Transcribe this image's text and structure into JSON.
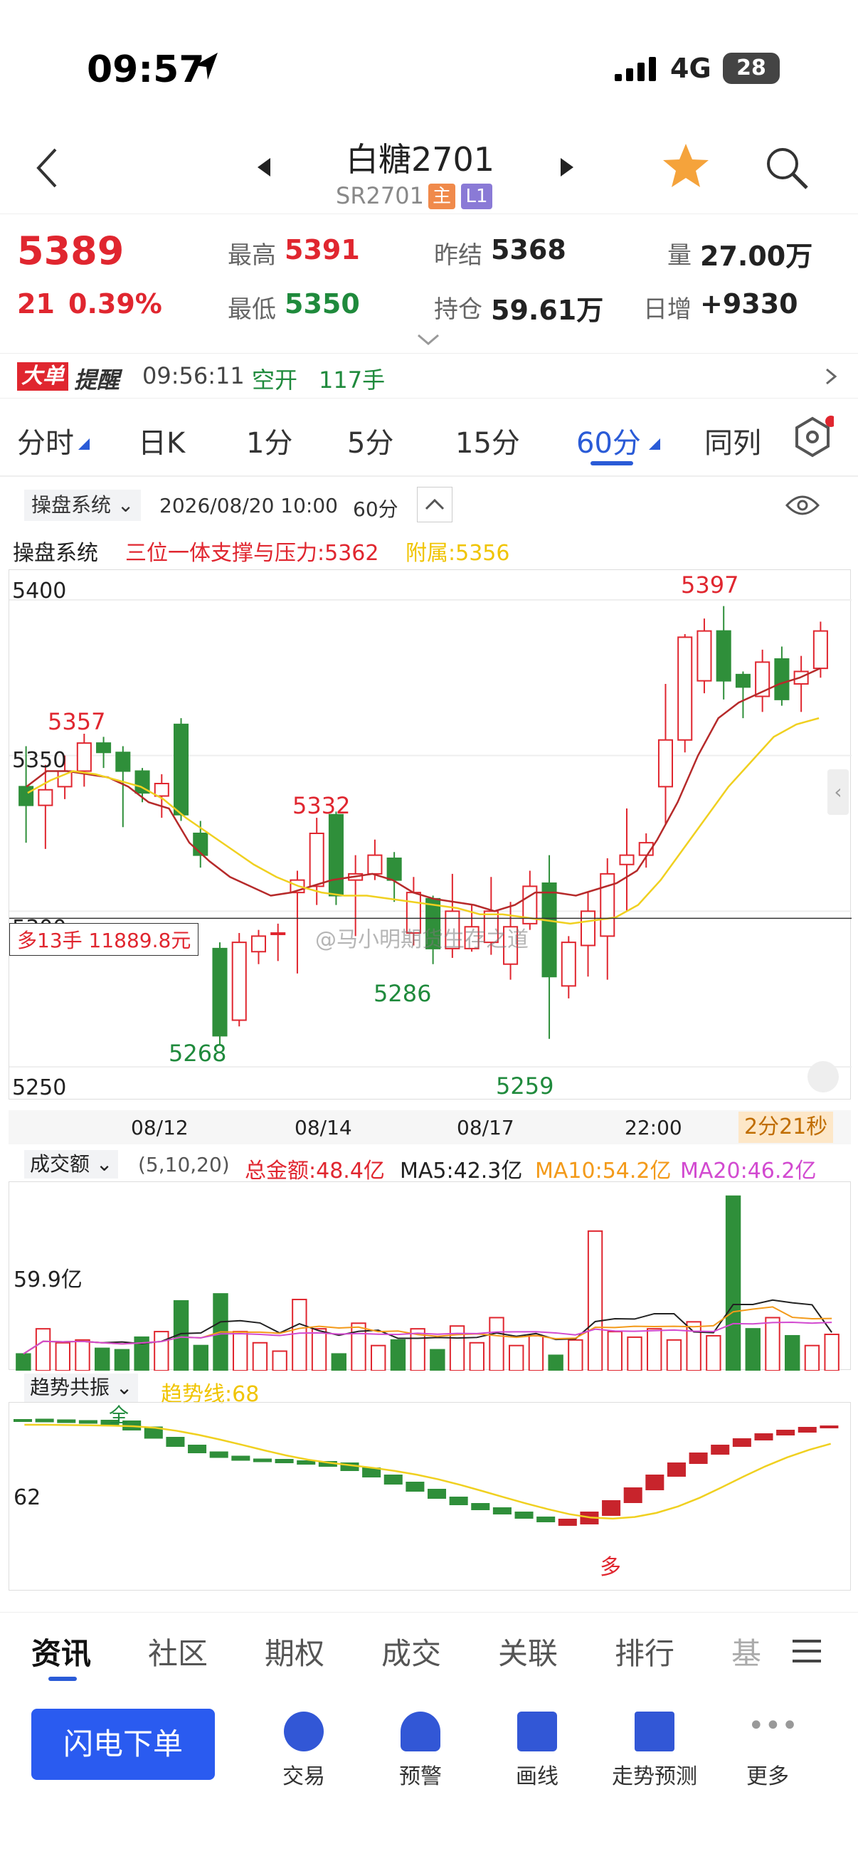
{
  "status": {
    "time": "09:57",
    "network": "4G",
    "battery": "28"
  },
  "header": {
    "title": "白糖2701",
    "code": "SR2701",
    "tag_main": "主",
    "tag_level": "L1"
  },
  "quote": {
    "price": "5389",
    "change": "21",
    "change_pct": "0.39%",
    "high_label": "最高",
    "high": "5391",
    "low_label": "最低",
    "low": "5350",
    "prev_label": "昨结",
    "prev": "5368",
    "oi_label": "持仓",
    "oi": "59.61万",
    "vol_label": "量",
    "vol": "27.00万",
    "daily_label": "日增",
    "daily": "+9330"
  },
  "alert": {
    "badge1": "大单",
    "badge2": "提醒",
    "time": "09:56:11",
    "type": "空开",
    "qty": "117手"
  },
  "periods": [
    "分时",
    "日K",
    "1分",
    "5分",
    "15分",
    "60分",
    "同列"
  ],
  "active_period": "60分",
  "chart_header": {
    "system": "操盘系统",
    "datetime": "2026/08/20 10:00",
    "period": "60分",
    "sys_label": "操盘系统",
    "line1": "三位一体支撑与压力:5362",
    "line2": "附属:5356"
  },
  "price_axis": [
    "5400",
    "5350",
    "5300",
    "5250"
  ],
  "price_marks": {
    "m5357": "5357",
    "m5332": "5332",
    "m5397": "5397",
    "m5268": "5268",
    "m5286": "5286",
    "m5259": "5259"
  },
  "position_box": "多13手 11889.8元",
  "watermark": "@马小明期货生存之道",
  "x_labels": [
    "08/12",
    "08/14",
    "08/17",
    "22:00"
  ],
  "countdown": "2分21秒",
  "volume": {
    "label": "成交额",
    "params": "(5,10,20)",
    "total": "总金额:48.4亿",
    "ma5": "MA5:42.3亿",
    "ma10": "MA10:54.2亿",
    "ma20": "MA20:46.2亿",
    "axis": "59.9亿"
  },
  "trend": {
    "label": "趋势共振",
    "line": "趋势线:68",
    "axis": "62",
    "mark_full": "全",
    "mark_more": "多"
  },
  "bottom_tabs": [
    "资讯",
    "社区",
    "期权",
    "成交",
    "关联",
    "排行",
    "基"
  ],
  "footer": {
    "order": "闪电下单",
    "items": [
      "交易",
      "预警",
      "画线",
      "走势预测",
      "更多"
    ]
  },
  "chart_data": {
    "type": "candlestick",
    "ylim": [
      5245,
      5405
    ],
    "candles": [
      [
        5340,
        5334,
        5353,
        5322
      ],
      [
        5334,
        5339,
        5347,
        5320
      ],
      [
        5340,
        5345,
        5350,
        5336
      ],
      [
        5345,
        5354,
        5357,
        5340
      ],
      [
        5354,
        5351,
        5356,
        5346
      ],
      [
        5351,
        5345,
        5353,
        5327
      ],
      [
        5345,
        5338,
        5346,
        5335
      ],
      [
        5337,
        5341,
        5344,
        5330
      ],
      [
        5360,
        5331,
        5362,
        5329
      ],
      [
        5325,
        5318,
        5329,
        5314
      ],
      [
        5288,
        5260,
        5290,
        5257
      ],
      [
        5265,
        5290,
        5293,
        5263
      ],
      [
        5287,
        5292,
        5294,
        5283
      ],
      [
        5293,
        5293,
        5296,
        5284
      ],
      [
        5306,
        5310,
        5313,
        5280
      ],
      [
        5308,
        5325,
        5330,
        5302
      ],
      [
        5331,
        5305,
        5332,
        5302
      ],
      [
        5310,
        5312,
        5318,
        5292
      ],
      [
        5312,
        5318,
        5323,
        5310
      ],
      [
        5317,
        5310,
        5319,
        5303
      ],
      [
        5293,
        5306,
        5311,
        5289
      ],
      [
        5304,
        5288,
        5305,
        5283
      ],
      [
        5288,
        5300,
        5312,
        5285
      ],
      [
        5288,
        5295,
        5302,
        5287
      ],
      [
        5290,
        5300,
        5311,
        5286
      ],
      [
        5283,
        5295,
        5303,
        5278
      ],
      [
        5296,
        5308,
        5313,
        5294
      ],
      [
        5309,
        5279,
        5318,
        5259
      ],
      [
        5276,
        5290,
        5292,
        5272
      ],
      [
        5289,
        5300,
        5306,
        5279
      ],
      [
        5292,
        5312,
        5317,
        5278
      ],
      [
        5315,
        5318,
        5333,
        5300
      ],
      [
        5318,
        5322,
        5325,
        5314
      ],
      [
        5340,
        5355,
        5373,
        5328
      ],
      [
        5355,
        5388,
        5389,
        5351
      ],
      [
        5374,
        5390,
        5394,
        5370
      ],
      [
        5390,
        5374,
        5398,
        5368
      ],
      [
        5376,
        5372,
        5377,
        5362
      ],
      [
        5369,
        5380,
        5384,
        5364
      ],
      [
        5381,
        5368,
        5385,
        5366
      ],
      [
        5373,
        5377,
        5382,
        5364
      ],
      [
        5378,
        5390,
        5393,
        5375
      ]
    ],
    "ma_red": [
      5340,
      5345,
      5345,
      5344,
      5343,
      5340,
      5335,
      5333,
      5322,
      5316,
      5311,
      5308,
      5305,
      5306,
      5308,
      5310,
      5311,
      5312,
      5310,
      5306,
      5304,
      5303,
      5302,
      5300,
      5302,
      5306,
      5306,
      5305,
      5307,
      5309,
      5313,
      5323,
      5335,
      5350,
      5362,
      5367,
      5370,
      5373,
      5375,
      5378
    ],
    "ma_yellow": [
      5338,
      5342,
      5345,
      5344,
      5342,
      5340,
      5336,
      5330,
      5325,
      5320,
      5315,
      5311,
      5308,
      5306,
      5305,
      5305,
      5304,
      5303,
      5302,
      5301,
      5299,
      5299,
      5298,
      5297,
      5296,
      5297,
      5298,
      5302,
      5310,
      5320,
      5330,
      5340,
      5348,
      5356,
      5360,
      5362
    ],
    "volume": [
      12,
      30,
      20,
      22,
      16,
      15,
      24,
      28,
      50,
      18,
      55,
      28,
      20,
      14,
      51,
      30,
      12,
      34,
      18,
      22,
      30,
      15,
      32,
      20,
      38,
      18,
      25,
      11,
      22,
      100,
      28,
      24,
      30,
      22,
      35,
      25,
      125,
      30,
      38,
      25,
      18,
      26
    ]
  }
}
